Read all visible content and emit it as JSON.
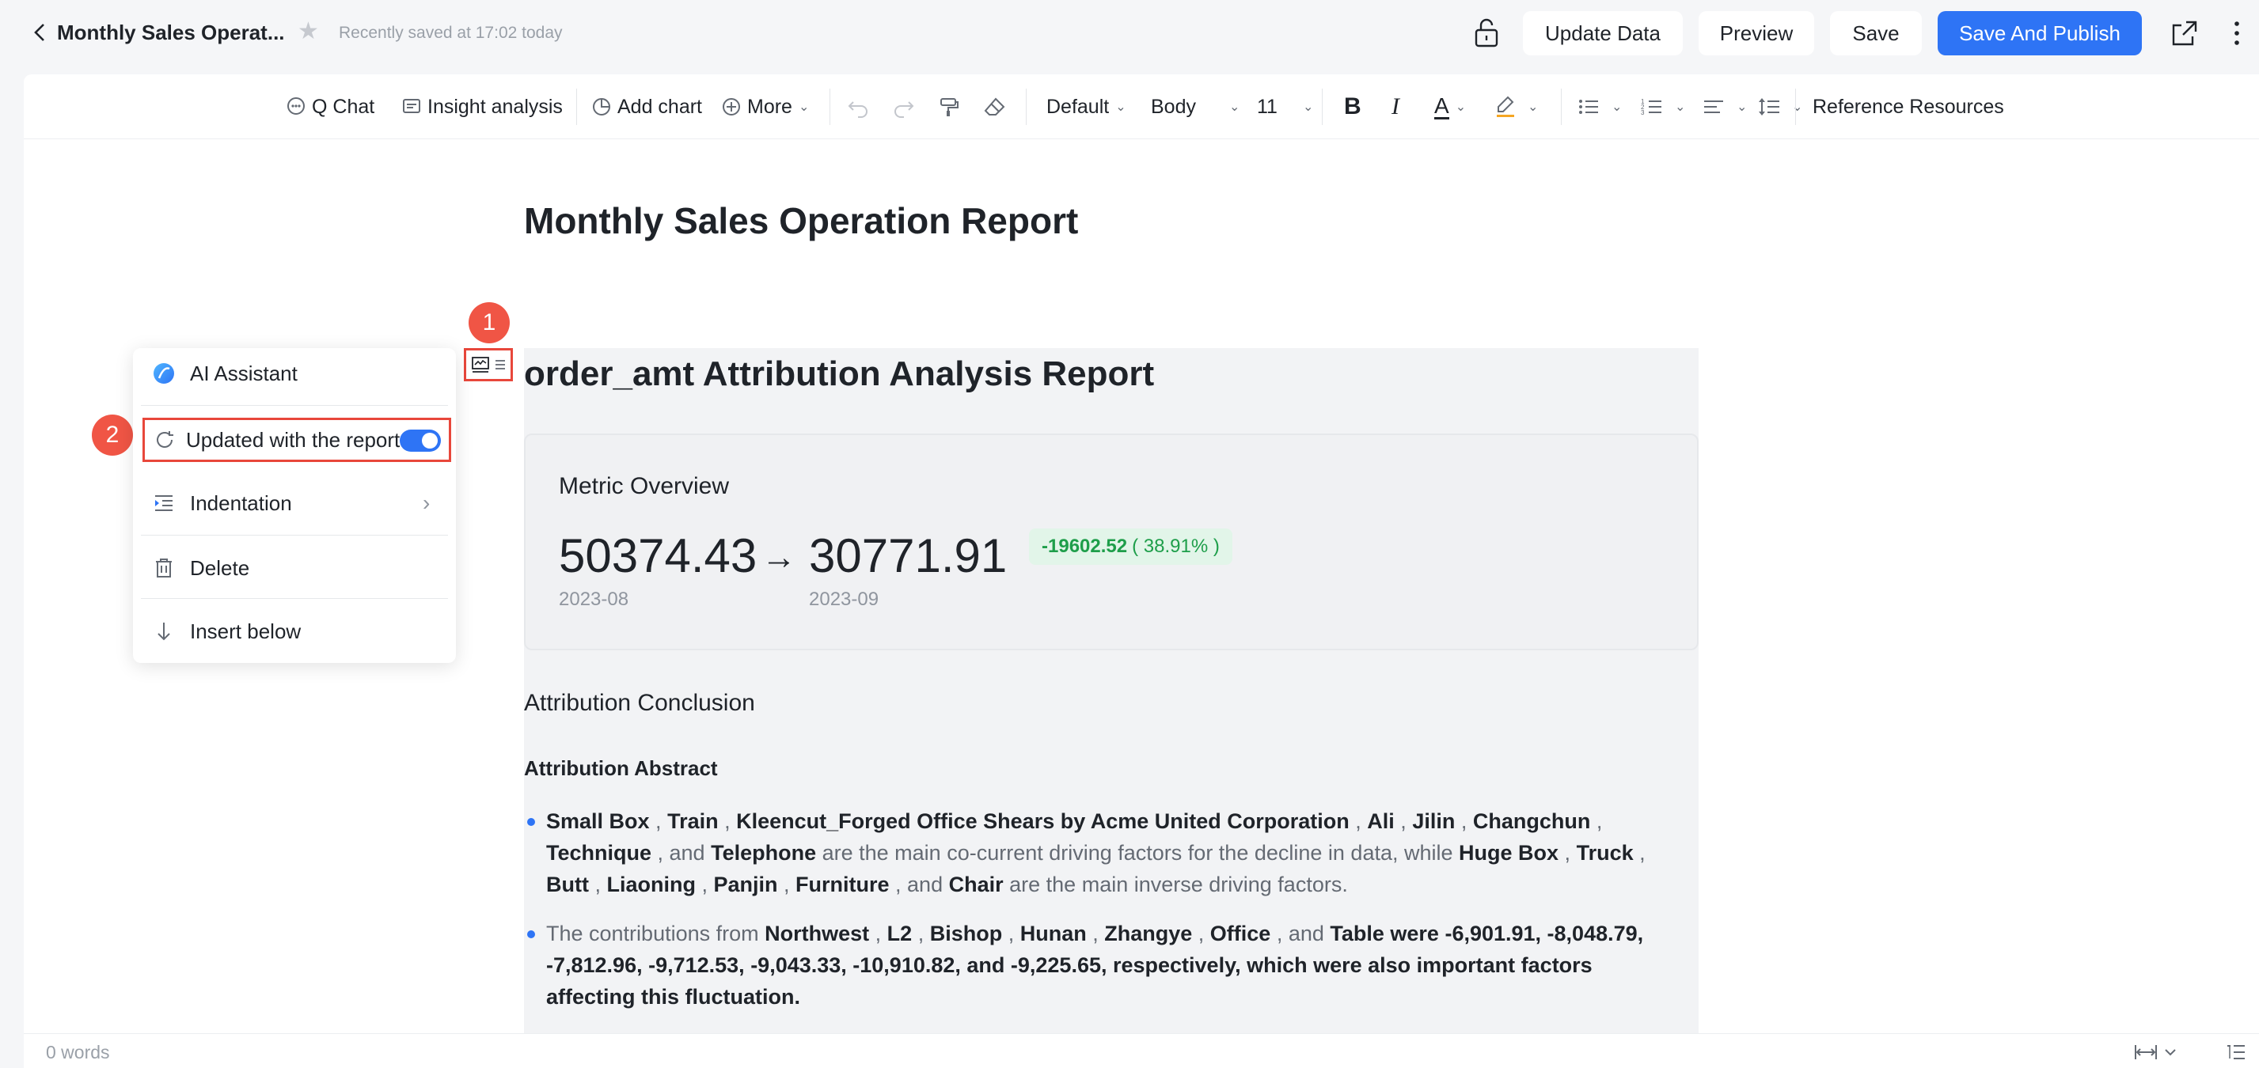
{
  "header": {
    "doc_title": "Monthly Sales Operat...",
    "saved_status": "Recently saved at 17:02 today",
    "buttons": {
      "update_data": "Update Data",
      "preview": "Preview",
      "save": "Save",
      "save_publish": "Save And Publish"
    }
  },
  "toolbar": {
    "q_chat": "Q Chat",
    "insight_analysis": "Insight analysis",
    "add_chart": "Add chart",
    "more": "More",
    "style": "Default",
    "paragraph": "Body",
    "font_size": "11",
    "bold": "B",
    "italic": "I",
    "text_color": "A",
    "reference": "Reference Resources"
  },
  "document": {
    "title": "Monthly Sales Operation Report",
    "block_title": "order_amt Attribution Analysis Report",
    "metric": {
      "heading": "Metric Overview",
      "from_value": "50374.43",
      "arrow": "→",
      "to_value": "30771.91",
      "from_date": "2023-08",
      "to_date": "2023-09",
      "delta": "-19602.52",
      "delta_pct": "( 38.91% )"
    },
    "conclusion_heading": "Attribution Conclusion",
    "abstract_heading": "Attribution Abstract",
    "bullet1": {
      "co_factors": [
        "Small Box",
        "Train",
        "Kleencut_Forged Office Shears by Acme United Corporation",
        "Ali",
        "Jilin",
        "Changchun",
        "Technique"
      ],
      "co_last": "Telephone",
      "mid_text": "are the main co-current driving factors for the decline in data, while",
      "inv_factors": [
        "Huge Box",
        "Truck",
        "Butt",
        "Liaoning",
        "Panjin",
        "Furniture"
      ],
      "inv_last": "Chair",
      "end_text": "are the main inverse driving factors."
    },
    "bullet2": {
      "intro": "The contributions from",
      "factors": [
        "Northwest",
        "L2",
        "Bishop",
        "Hunan",
        "Zhangye",
        "Office"
      ],
      "last_factor": "Table",
      "values_text": "were -6,901.91, -8,048.79, -7,812.96, -9,712.53, -9,043.33, -10,910.82, and -9,225.65, respectively, which were also important factors affecting this fluctuation."
    }
  },
  "context_menu": {
    "ai_assistant": "AI Assistant",
    "updated_with_report": "Updated with the report",
    "indentation": "Indentation",
    "delete": "Delete",
    "insert_below": "Insert below",
    "toggle_on": true
  },
  "annotations": {
    "step1": "1",
    "step2": "2"
  },
  "status_bar": {
    "word_count": "0 words"
  },
  "colors": {
    "accent": "#2e74f5",
    "annotation": "#e8473b",
    "positive_delta": "#1e9e4a"
  }
}
